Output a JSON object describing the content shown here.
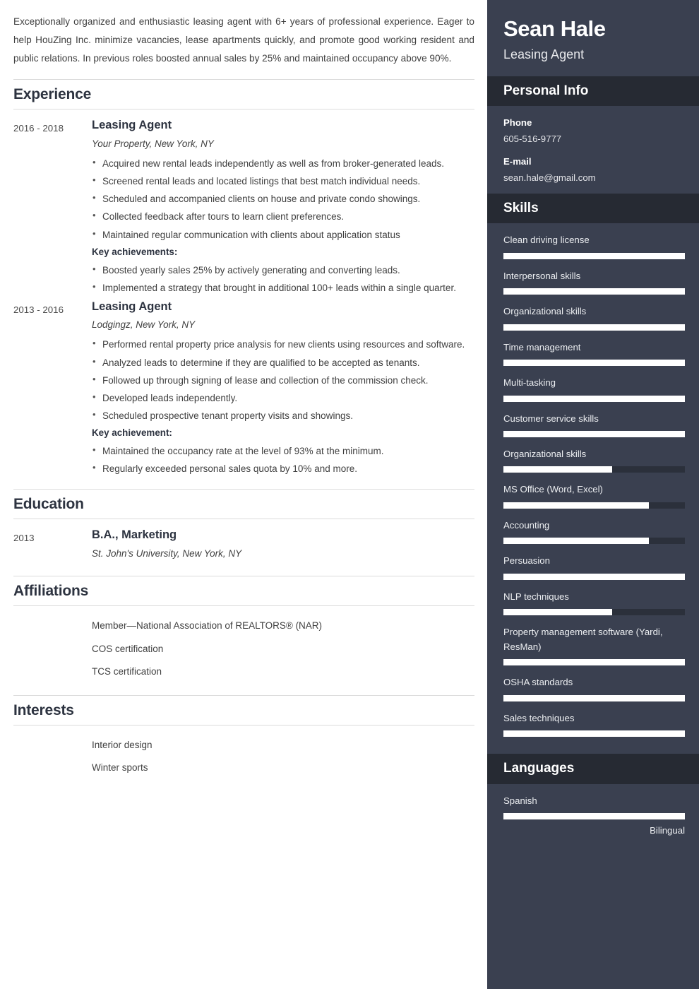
{
  "summary": "Exceptionally organized and enthusiastic leasing agent with 6+ years of professional experience. Eager to help HouZing Inc. minimize vacancies, lease apartments quickly, and promote good working resident and public relations. In previous roles boosted annual sales by 25% and maintained occupancy above 90%.",
  "sections": {
    "experience": {
      "heading": "Experience",
      "entries": [
        {
          "date": "2016 - 2018",
          "title": "Leasing Agent",
          "subtitle": "Your Property, New York, NY",
          "bullets": [
            "Acquired new rental leads independently as well as from broker-generated leads.",
            "Screened rental leads and located listings that best match individual needs.",
            "Scheduled and accompanied clients on house and private condo showings.",
            "Collected feedback after tours to learn client preferences.",
            "Maintained regular communication with clients about application status"
          ],
          "achievements_label": "Key achievements:",
          "achievements": [
            "Boosted yearly sales 25% by actively generating and converting leads.",
            "Implemented a strategy that brought in additional 100+ leads within a single quarter."
          ]
        },
        {
          "date": "2013 - 2016",
          "title": "Leasing Agent",
          "subtitle": "Lodgingz, New York, NY",
          "bullets": [
            "Performed rental property price analysis for new clients using resources and software.",
            "Analyzed leads to determine if they are qualified to be accepted as tenants.",
            "Followed up through signing of lease and collection of the commission check.",
            "Developed leads independently.",
            "Scheduled prospective tenant property visits and showings."
          ],
          "achievements_label": "Key achievement:",
          "achievements": [
            "Maintained the occupancy rate at the level of 93% at the minimum.",
            "Regularly exceeded personal sales quota by 10% and more."
          ]
        }
      ]
    },
    "education": {
      "heading": "Education",
      "entries": [
        {
          "date": "2013",
          "title": "B.A., Marketing",
          "subtitle": "St. John's University, New York, NY"
        }
      ]
    },
    "affiliations": {
      "heading": "Affiliations",
      "items": [
        "Member—National Association of REALTORS® (NAR)",
        "COS certification",
        "TCS certification"
      ]
    },
    "interests": {
      "heading": "Interests",
      "items": [
        "Interior design",
        "Winter sports"
      ]
    }
  },
  "sidebar": {
    "name": "Sean Hale",
    "role": "Leasing Agent",
    "personal_info": {
      "heading": "Personal Info",
      "fields": [
        {
          "label": "Phone",
          "value": "605-516-9777"
        },
        {
          "label": "E-mail",
          "value": "sean.hale@gmail.com"
        }
      ]
    },
    "skills": {
      "heading": "Skills",
      "items": [
        {
          "name": "Clean driving license",
          "level": 100
        },
        {
          "name": "Interpersonal skills",
          "level": 100
        },
        {
          "name": "Organizational skills",
          "level": 100
        },
        {
          "name": "Time management",
          "level": 100
        },
        {
          "name": "Multi-tasking",
          "level": 100
        },
        {
          "name": "Customer service skills",
          "level": 100
        },
        {
          "name": "Organizational skills",
          "level": 60
        },
        {
          "name": "MS Office (Word, Excel)",
          "level": 80
        },
        {
          "name": "Accounting",
          "level": 80
        },
        {
          "name": "Persuasion",
          "level": 100
        },
        {
          "name": "NLP techniques",
          "level": 60
        },
        {
          "name": "Property management software (Yardi, ResMan)",
          "level": 100
        },
        {
          "name": "OSHA standards",
          "level": 100
        },
        {
          "name": "Sales techniques",
          "level": 100
        }
      ]
    },
    "languages": {
      "heading": "Languages",
      "items": [
        {
          "name": "Spanish",
          "level": 100,
          "proficiency": "Bilingual"
        }
      ]
    }
  },
  "colors": {
    "sidebar_bg": "#3a4050",
    "sidebar_head_bg": "#262a33",
    "bar_fill": "#ffffff",
    "bar_track": "#2b303b",
    "heading_text": "#2d3340"
  }
}
